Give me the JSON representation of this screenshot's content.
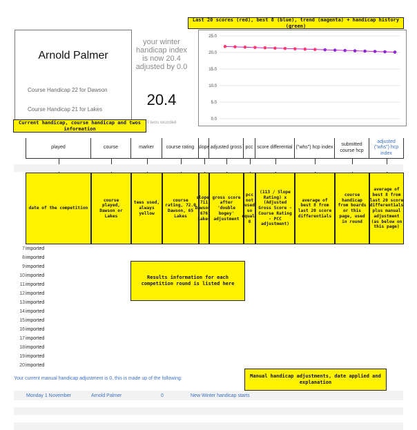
{
  "player": {
    "name": "Arnold Palmer",
    "course_handicaps": [
      "Course Handicap 22 for Dawson",
      "Course Handicap 21 for Lakes"
    ]
  },
  "handicap": {
    "summary": "your winter handicap index is now 20.4 adjusted by 0.0",
    "index": "20.4",
    "twos": "0 twos recorded"
  },
  "chart_title": "Last 20 scores (red), best 8 (blue), trend (magenta) + handicap history (green)",
  "chart_data": {
    "type": "line",
    "ylim": [
      0,
      25
    ],
    "yticks": [
      "0.0",
      "5.0",
      "10.0",
      "15.0",
      "20.0",
      "25.0"
    ],
    "grid": true,
    "series": [
      {
        "color": "#ff3b6b",
        "values": [
          21.8,
          21.7,
          21.6,
          21.5,
          21.4,
          21.3,
          21.2,
          21.1,
          21.0,
          20.9
        ]
      },
      {
        "color": "#8a2bd0",
        "values": [
          20.8,
          20.7,
          20.6,
          20.5,
          20.4,
          20.3,
          20.2,
          20.1
        ]
      }
    ]
  },
  "banner_current": "Current handicap, course handicap and twos information",
  "columns": [
    {
      "label": "played",
      "desc": "date of the competition"
    },
    {
      "label": "course",
      "desc": "course played, Dawson or Lakes"
    },
    {
      "label": "marker",
      "desc": "tees used, always yellow"
    },
    {
      "label": "course rating",
      "desc": "course rating, 72.0 Dawson, 65 Lakes"
    },
    {
      "label": "slope",
      "desc": "slope, 711 Dawson, 676 Lakes"
    },
    {
      "label": "adjusted gross",
      "desc": "gross score after 'double bogey' adjustment"
    },
    {
      "label": "pcc",
      "desc": "pcc not used so equals 0"
    },
    {
      "label": "score differential",
      "desc": "(113 / Slope Rating) x (Adjusted Gross Score - Course Rating - PCC adjustment)"
    },
    {
      "label": "(\"whs\") hcp index",
      "desc": "average of best 8 from last 20 score differentials"
    },
    {
      "label": "submitted course hcp",
      "desc": "course handicap from boards or this page, used in round"
    },
    {
      "label": "adjusted (\"whs\") hcp index",
      "desc": "average of best 8 from last 20 score differentials plus manual adjustment (as below on this page)"
    }
  ],
  "rows": [
    {
      "n": "7",
      "t": "imported"
    },
    {
      "n": "8",
      "t": "imported"
    },
    {
      "n": "9",
      "t": "imported"
    },
    {
      "n": "10",
      "t": "imported"
    },
    {
      "n": "11",
      "t": "imported"
    },
    {
      "n": "12",
      "t": "imported"
    },
    {
      "n": "13",
      "t": "imported"
    },
    {
      "n": "14",
      "t": "imported"
    },
    {
      "n": "15",
      "t": "imported"
    },
    {
      "n": "16",
      "t": "imported"
    },
    {
      "n": "17",
      "t": "imported"
    },
    {
      "n": "18",
      "t": "imported"
    },
    {
      "n": "19",
      "t": "imported"
    },
    {
      "n": "20",
      "t": "imported"
    }
  ],
  "results_note": "Results information for each competition round is listed here",
  "adjustment": {
    "text": "Your current manual handicap adjustment is 0, this is made up of the following:",
    "note": "Manual handicap adjustments, date applied and explanation",
    "row": {
      "date": "Monday 1 November",
      "player": "Arnold Palmer",
      "value": "0",
      "desc": "New Winter handicap starts"
    }
  },
  "colors": {
    "highlight": "#fff200",
    "link_blue": "#3a6fc4",
    "score_red": "#ff3b6b",
    "best_purple": "#8a2bd0"
  }
}
